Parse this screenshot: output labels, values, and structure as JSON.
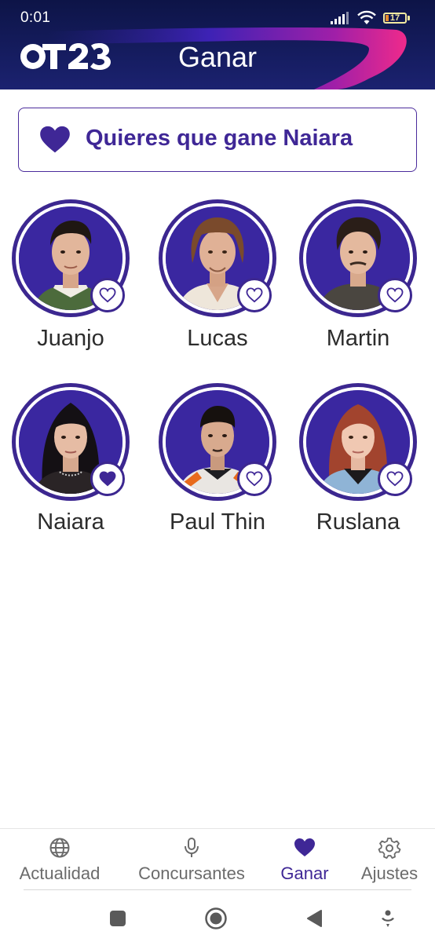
{
  "status_bar": {
    "time": "0:01",
    "battery_level": "17",
    "icons": [
      "signal-icon",
      "wifi-icon",
      "battery-icon"
    ]
  },
  "header": {
    "logo_text": "OT23",
    "title": "Ganar"
  },
  "banner": {
    "text": "Quieres que gane Naiara",
    "icon": "heart-filled-icon"
  },
  "colors": {
    "accent": "#3f2796",
    "header_bg": "#0d1447",
    "swoosh": "#e0218a",
    "avatar_bg": "#3a27a0"
  },
  "contestants": [
    {
      "name": "Juanjo",
      "voted": false
    },
    {
      "name": "Lucas",
      "voted": false
    },
    {
      "name": "Martin",
      "voted": false
    },
    {
      "name": "Naiara",
      "voted": true
    },
    {
      "name": "Paul Thin",
      "voted": false
    },
    {
      "name": "Ruslana",
      "voted": false
    }
  ],
  "bottom_nav": {
    "items": [
      {
        "label": "Actualidad",
        "icon": "globe-icon",
        "active": false
      },
      {
        "label": "Concursantes",
        "icon": "microphone-icon",
        "active": false
      },
      {
        "label": "Ganar",
        "icon": "heart-icon",
        "active": true
      },
      {
        "label": "Ajustes",
        "icon": "gear-icon",
        "active": false
      }
    ]
  },
  "system_nav": {
    "buttons": [
      "recents-square-icon",
      "home-circle-icon",
      "back-triangle-icon",
      "assistant-icon"
    ]
  }
}
